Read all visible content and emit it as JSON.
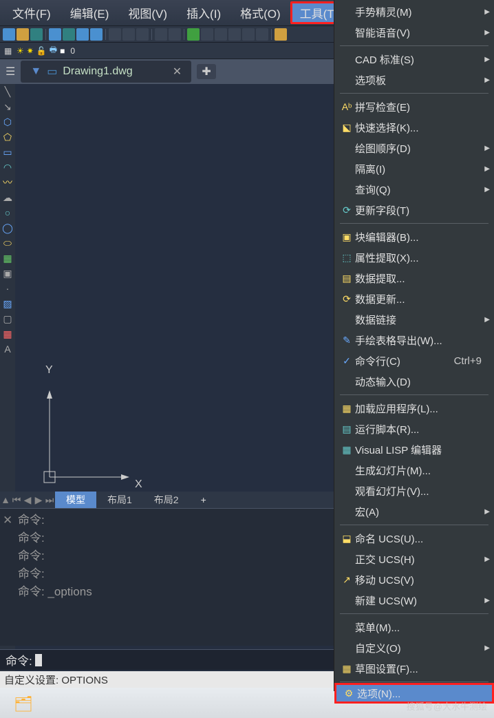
{
  "menubar": {
    "file": "文件(F)",
    "edit": "编辑(E)",
    "view": "视图(V)",
    "insert": "插入(I)",
    "format": "格式(O)",
    "tools": "工具(T)"
  },
  "document": {
    "name": "Drawing1.dwg"
  },
  "layer": {
    "name": "0"
  },
  "ucs": {
    "y": "Y",
    "x": "X"
  },
  "layout_tabs": {
    "model": "模型",
    "layout1": "布局1",
    "layout2": "布局2",
    "add": "+"
  },
  "cmd_history": {
    "line1": "命令:",
    "line2": "命令:",
    "line3": "命令:",
    "line4": "命令:",
    "line5": "命令: _options"
  },
  "cmd_input": {
    "prompt": "命令:"
  },
  "status": {
    "text": "自定义设置: OPTIONS"
  },
  "ctx": {
    "gesture": "手势精灵(M)",
    "voice": "智能语音(V)",
    "cadstd": "CAD 标准(S)",
    "palettes": "选项板",
    "spell": "拼写检查(E)",
    "qselect": "快速选择(K)...",
    "draworder": "绘图顺序(D)",
    "isolate": "隔离(I)",
    "inquiry": "查询(Q)",
    "updfields": "更新字段(T)",
    "bedit": "块编辑器(B)...",
    "attext": "属性提取(X)...",
    "dataext": "数据提取...",
    "dataupd": "数据更新...",
    "datalink": "数据链接",
    "handtable": "手绘表格导出(W)...",
    "cmdline": "命令行(C)",
    "cmdline_accel": "Ctrl+9",
    "dyninput": "动态输入(D)",
    "loadapp": "加载应用程序(L)...",
    "runscript": "运行脚本(R)...",
    "vlisp": "Visual LISP 编辑器",
    "makeslide": "生成幻灯片(M)...",
    "viewslide": "观看幻灯片(V)...",
    "macro": "宏(A)",
    "namedUCS": "命名 UCS(U)...",
    "orthoUCS": "正交 UCS(H)",
    "moveUCS": "移动 UCS(V)",
    "newUCS": "新建 UCS(W)",
    "menu": "菜单(M)...",
    "customize": "自定义(O)",
    "draftset": "草图设置(F)...",
    "options": "选项(N)..."
  },
  "watermark": "搜狐号@大水牛测绘"
}
